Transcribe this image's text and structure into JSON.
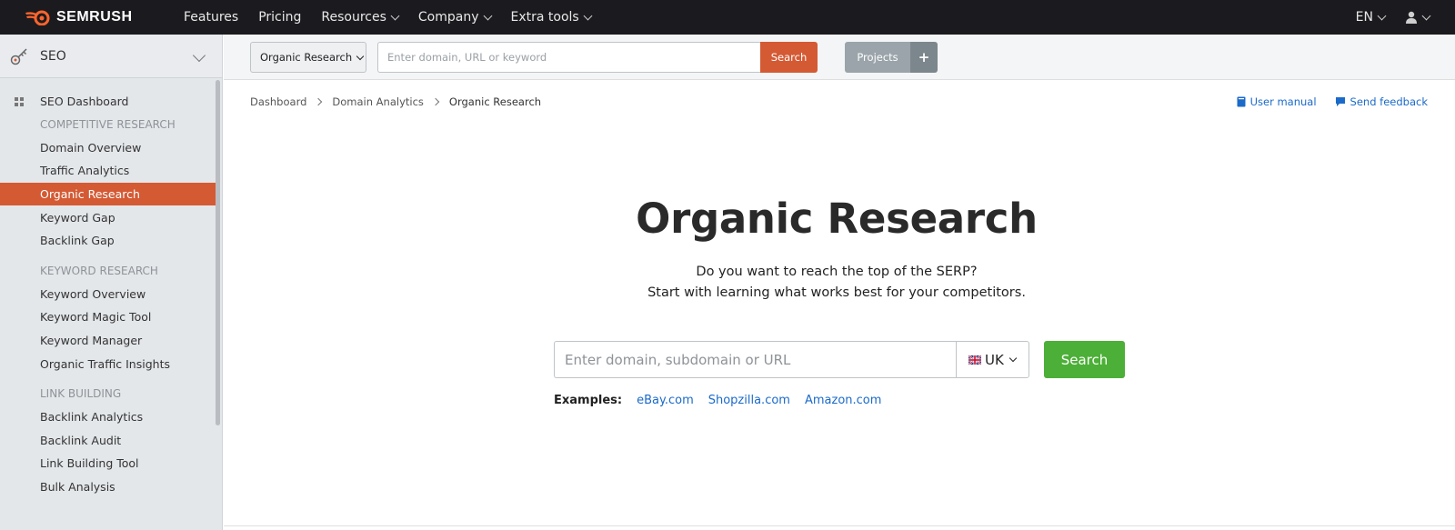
{
  "topnav": {
    "brand": "SEMRUSH",
    "items": [
      {
        "label": "Features",
        "has_menu": false
      },
      {
        "label": "Pricing",
        "has_menu": false
      },
      {
        "label": "Resources",
        "has_menu": true
      },
      {
        "label": "Company",
        "has_menu": true
      },
      {
        "label": "Extra tools",
        "has_menu": true
      }
    ],
    "lang": "EN"
  },
  "sidebar": {
    "header": "SEO",
    "dashboard": "SEO Dashboard",
    "sections": [
      {
        "title": "COMPETITIVE RESEARCH",
        "items": [
          "Domain Overview",
          "Traffic Analytics",
          "Organic Research",
          "Keyword Gap",
          "Backlink Gap"
        ]
      },
      {
        "title": "KEYWORD RESEARCH",
        "items": [
          "Keyword Overview",
          "Keyword Magic Tool",
          "Keyword Manager",
          "Organic Traffic Insights"
        ]
      },
      {
        "title": "LINK BUILDING",
        "items": [
          "Backlink Analytics",
          "Backlink Audit",
          "Link Building Tool",
          "Bulk Analysis"
        ]
      }
    ],
    "active_item": "Organic Research"
  },
  "toolbar": {
    "tool_select": "Organic Research",
    "search_placeholder": "Enter domain, URL or keyword",
    "search_label": "Search",
    "projects_label": "Projects",
    "add_label": "+"
  },
  "breadcrumb": [
    "Dashboard",
    "Domain Analytics",
    "Organic Research"
  ],
  "help": {
    "manual": "User manual",
    "feedback": "Send feedback"
  },
  "main": {
    "title": "Organic Research",
    "subtitle_1": "Do you want to reach the top of the SERP?",
    "subtitle_2": "Start with learning what works best for your competitors.",
    "search_placeholder": "Enter domain, subdomain or URL",
    "country": "UK",
    "search_label": "Search",
    "examples_label": "Examples:",
    "examples": [
      "eBay.com",
      "Shopzilla.com",
      "Amazon.com"
    ]
  },
  "colors": {
    "brand_orange": "#d45a34",
    "search_green": "#4caf37",
    "link_blue": "#1b6ac9",
    "topnav_bg": "#1b1b1f",
    "sidebar_bg": "#e4e7ea"
  }
}
